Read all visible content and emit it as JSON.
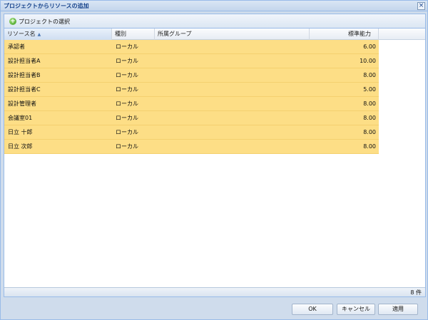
{
  "dialog": {
    "title": "プロジェクトからリソースの追加"
  },
  "toolbar": {
    "select_project_label": "プロジェクトの選択"
  },
  "grid": {
    "columns": {
      "name": "リソース名",
      "type": "種別",
      "group": "所属グループ",
      "capacity": "標準能力"
    },
    "rows": [
      {
        "name": "承認者",
        "type": "ローカル",
        "group": "",
        "capacity": "6.00"
      },
      {
        "name": "設計担当者A",
        "type": "ローカル",
        "group": "",
        "capacity": "10.00"
      },
      {
        "name": "設計担当者B",
        "type": "ローカル",
        "group": "",
        "capacity": "8.00"
      },
      {
        "name": "設計担当者C",
        "type": "ローカル",
        "group": "",
        "capacity": "5.00"
      },
      {
        "name": "設計管理者",
        "type": "ローカル",
        "group": "",
        "capacity": "8.00"
      },
      {
        "name": "会議室01",
        "type": "ローカル",
        "group": "",
        "capacity": "8.00"
      },
      {
        "name": "日立 十郎",
        "type": "ローカル",
        "group": "",
        "capacity": "8.00"
      },
      {
        "name": "日立 次郎",
        "type": "ローカル",
        "group": "",
        "capacity": "8.00"
      }
    ]
  },
  "status": {
    "count": "8 件"
  },
  "buttons": {
    "ok": "OK",
    "cancel": "キャンセル",
    "apply": "適用"
  },
  "colors": {
    "selected_row": "#fdde86",
    "title_text": "#15428b"
  }
}
